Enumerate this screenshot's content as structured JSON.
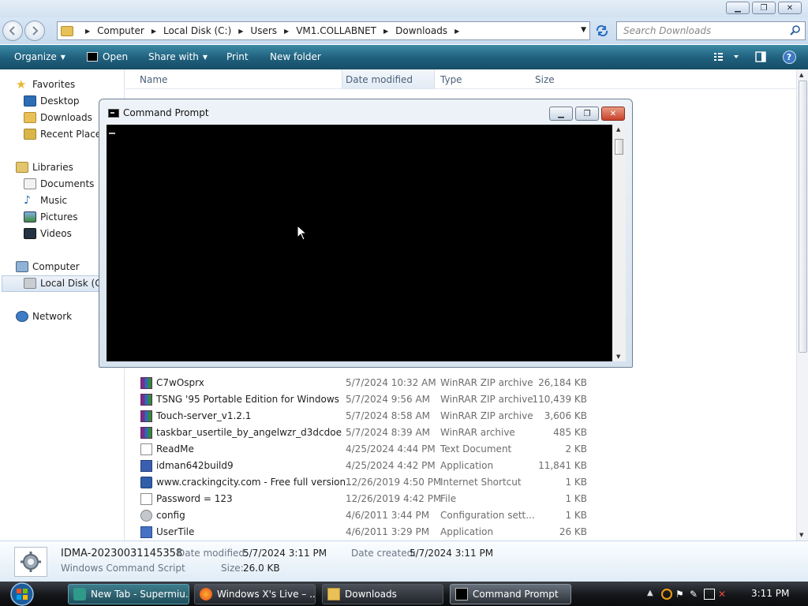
{
  "window": {
    "minimize": "▁",
    "restore": "❐",
    "close": "✕"
  },
  "address": {
    "crumbs": [
      "Computer",
      "Local Disk (C:)",
      "Users",
      "VM1.COLLABNET",
      "Downloads"
    ]
  },
  "search": {
    "placeholder": "Search Downloads"
  },
  "toolbar": {
    "organize": "Organize",
    "open": "Open",
    "share_with": "Share with",
    "print": "Print",
    "new_folder": "New folder",
    "help": "?"
  },
  "nav": {
    "favorites": "Favorites",
    "desktop": "Desktop",
    "downloads": "Downloads",
    "recent_places": "Recent Places",
    "libraries": "Libraries",
    "documents": "Documents",
    "music": "Music",
    "pictures": "Pictures",
    "videos": "Videos",
    "computer": "Computer",
    "local_disk": "Local Disk (C:)",
    "network": "Network"
  },
  "columns": {
    "name": "Name",
    "date": "Date modified",
    "type": "Type",
    "size": "Size"
  },
  "files": [
    {
      "name": "C7wOsprx",
      "date": "5/7/2024 10:32 AM",
      "type": "WinRAR ZIP archive",
      "size": "26,184 KB",
      "icon": "zip"
    },
    {
      "name": "TSNG '95 Portable Edition for Windows",
      "date": "5/7/2024 9:56 AM",
      "type": "WinRAR ZIP archive",
      "size": "110,439 KB",
      "icon": "zip"
    },
    {
      "name": "Touch-server_v1.2.1",
      "date": "5/7/2024 8:58 AM",
      "type": "WinRAR ZIP archive",
      "size": "3,606 KB",
      "icon": "zip"
    },
    {
      "name": "taskbar_usertile_by_angelwzr_d3dcdoe",
      "date": "5/7/2024 8:39 AM",
      "type": "WinRAR archive",
      "size": "485 KB",
      "icon": "zip"
    },
    {
      "name": "ReadMe",
      "date": "4/25/2024 4:44 PM",
      "type": "Text Document",
      "size": "2 KB",
      "icon": "txt"
    },
    {
      "name": "idman642build9",
      "date": "4/25/2024 4:42 PM",
      "type": "Application",
      "size": "11,841 KB",
      "icon": "app"
    },
    {
      "name": "www.crackingcity.com - Free full version...",
      "date": "12/26/2019 4:50 PM",
      "type": "Internet Shortcut",
      "size": "1 KB",
      "icon": "url"
    },
    {
      "name": "Password = 123",
      "date": "12/26/2019 4:42 PM",
      "type": "File",
      "size": "1 KB",
      "icon": "txt"
    },
    {
      "name": "config",
      "date": "4/6/2011 3:44 PM",
      "type": "Configuration sett...",
      "size": "1 KB",
      "icon": "cfg"
    },
    {
      "name": "UserTile",
      "date": "4/6/2011 3:29 PM",
      "type": "Application",
      "size": "26 KB",
      "icon": "usr"
    }
  ],
  "details": {
    "filename": "IDMA-20230031145358",
    "filetype": "Windows Command Script",
    "date_modified_label": "Date modified:",
    "date_modified": "5/7/2024 3:11 PM",
    "date_created_label": "Date created:",
    "date_created": "5/7/2024 3:11 PM",
    "size_label": "Size:",
    "size": "26.0 KB"
  },
  "cmd": {
    "title": "Command Prompt"
  },
  "taskbar": {
    "tasks": [
      "New Tab - Supermiu...",
      "Windows X's Live – ...",
      "Downloads",
      "Command Prompt"
    ],
    "clock": "3:11 PM"
  },
  "colors": {
    "toolbar": "#1f5f7c",
    "taskbar": "#141619",
    "console": "#000000",
    "accent": "#2a70c2"
  }
}
